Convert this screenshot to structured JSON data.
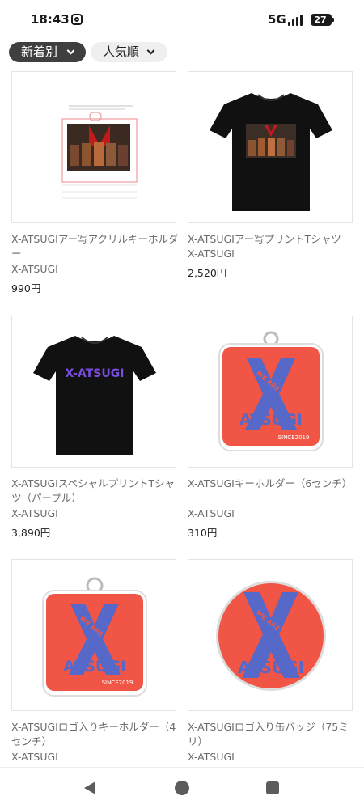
{
  "status_bar": {
    "time": "18:43",
    "network": "5G",
    "battery": "27",
    "icons": [
      "instagram-icon",
      "signal-icon",
      "battery-icon"
    ]
  },
  "sort": {
    "active_label": "新着別",
    "inactive_label": "人気順"
  },
  "products": [
    {
      "name": "X-ATSUGIアー写アクリルキーホルダー",
      "shop": "X-ATSUGI",
      "price": "990円",
      "image": "acrylic-keyholder-image"
    },
    {
      "name": "X-ATSUGIアー写プリントTシャツ",
      "shop": "X-ATSUGI",
      "price": "2,520円",
      "image": "photo-tshirt-image"
    },
    {
      "name": "X-ATSUGIスペシャルプリントTシャツ（パープル）",
      "shop": "X-ATSUGI",
      "price": "3,890円",
      "image": "purple-print-tshirt-image"
    },
    {
      "name": "X-ATSUGIキーホルダー（6センチ）",
      "shop": "X-ATSUGI",
      "price": "310円",
      "image": "keyholder-6cm-image"
    },
    {
      "name": "X-ATSUGIロゴ入りキーホルダー（4センチ）",
      "shop": "X-ATSUGI",
      "price": "",
      "image": "logo-keyholder-4cm-image"
    },
    {
      "name": "X-ATSUGIロゴ入り缶バッジ（75ミリ）",
      "shop": "X-ATSUGI",
      "price": "",
      "image": "can-badge-75mm-image"
    }
  ],
  "artwork": {
    "tshirt_print": "X-ATSUGI",
    "logo_letter": "X",
    "logo_name": "ATSUGI",
    "logo_tagline": "WE ARE X",
    "logo_since": "SINCE2019"
  },
  "colors": {
    "logo_red": "#f05545",
    "logo_blue": "#5668c8",
    "purple_print": "#7a4de0",
    "chip_active_bg": "#3f3f3f",
    "chip_inactive_bg": "#efefef"
  }
}
